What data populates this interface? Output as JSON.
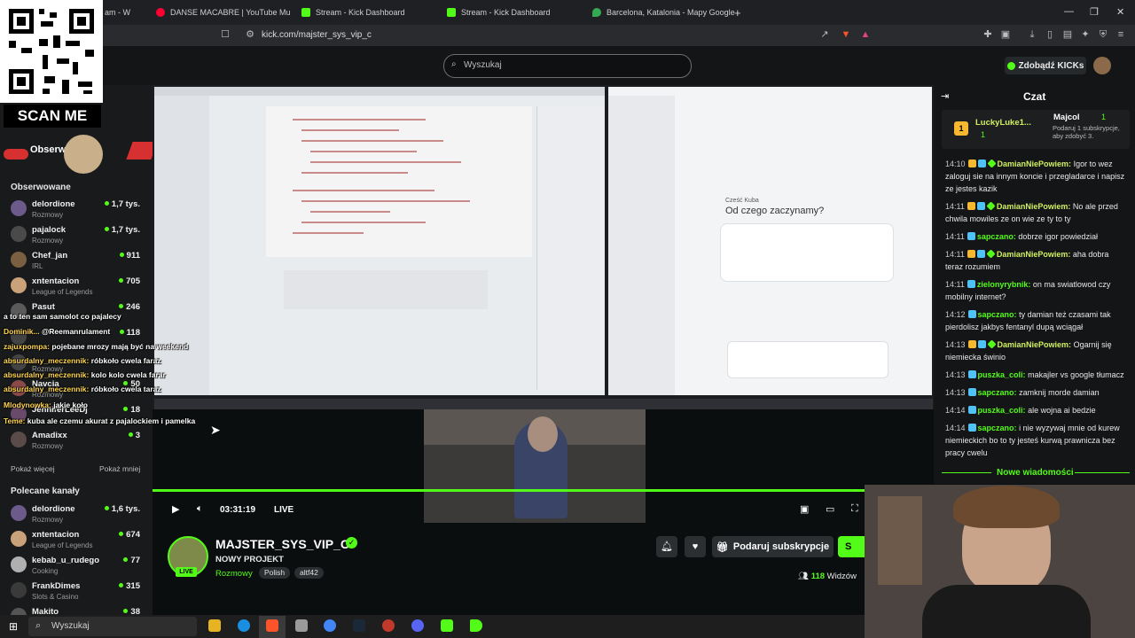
{
  "browser": {
    "tabs": [
      {
        "label": "am - W",
        "color": "#53fc18"
      },
      {
        "label": "DANSE MACABRE | YouTube Mu",
        "color": "#ff0033"
      },
      {
        "label": "Stream - Kick Dashboard",
        "color": "#53fc18"
      },
      {
        "label": "Stream - Kick Dashboard",
        "color": "#53fc18"
      },
      {
        "label": "Barcelona, Katalonia - Mapy Google",
        "color": "#34a853"
      }
    ],
    "new_tab": "+",
    "url": "kick.com/majster_sys_vip_c"
  },
  "kick": {
    "search_placeholder": "Wyszukaj",
    "get_kicks": "Zdobądź KICKs"
  },
  "overlay": {
    "scan_me": "SCAN ME",
    "follow_label": "Obserw",
    "chat_lines": [
      {
        "user": "",
        "text": "a to ten sam samolot co pajalecy"
      },
      {
        "user": "Dominik...",
        "text": "@Reemanrulament"
      },
      {
        "user": "zajuxpompa:",
        "text": "pojebane mrozy mają być na weekend"
      },
      {
        "user": "absurdalny_meczennik:",
        "text": "róbkoło cwela faraz"
      },
      {
        "user": "absurdalny_meczennik:",
        "text": "kolo kolo cwela farar"
      },
      {
        "user": "absurdalny_meczennik:",
        "text": "róbkoło cwela taraz"
      },
      {
        "user": "Mlodynowka:",
        "text": "jakie koło"
      },
      {
        "user": "Teme:",
        "text": "kuba ale czemu akurat z pajalockiem i pamelka"
      }
    ]
  },
  "sidebar": {
    "followed_title": "Obserwowane",
    "followed": [
      {
        "name": "delordione",
        "category": "Rozmowy",
        "viewers": "1,7 tys.",
        "color": "#6b5a8a"
      },
      {
        "name": "pajalock",
        "category": "Rozmowy",
        "viewers": "1,7 tys.",
        "color": "#4a4a4a"
      },
      {
        "name": "Chef_jan",
        "category": "IRL",
        "viewers": "911",
        "color": "#7a6040"
      },
      {
        "name": "xntentacion",
        "category": "League of Legends",
        "viewers": "705",
        "color": "#c9a27a"
      },
      {
        "name": "Pasut",
        "category": "",
        "viewers": "246",
        "color": "#5a5a5a"
      },
      {
        "name": "",
        "category": "",
        "viewers": "118",
        "color": "#444"
      },
      {
        "name": "",
        "category": "Rozmowy",
        "viewers": "",
        "color": "#444"
      },
      {
        "name": "Navcia",
        "category": "Rozmowy",
        "viewers": "50",
        "color": "#8a4a4a"
      },
      {
        "name": "JenniferLeeDj",
        "category": "",
        "viewers": "18",
        "color": "#6a4a6a"
      },
      {
        "name": "Amadixx",
        "category": "Rozmowy",
        "viewers": "3",
        "color": "#5a4a4a"
      }
    ],
    "show_more": "Pokaż więcej",
    "show_less": "Pokaż mniej",
    "recommended_title": "Polecane kanały",
    "recommended": [
      {
        "name": "delordione",
        "category": "Rozmowy",
        "viewers": "1,6 tys.",
        "color": "#6b5a8a"
      },
      {
        "name": "xntentacion",
        "category": "League of Legends",
        "viewers": "674",
        "color": "#c9a27a"
      },
      {
        "name": "kebab_u_rudego",
        "category": "Cooking",
        "viewers": "77",
        "color": "#b0b0b0"
      },
      {
        "name": "FrankDimes",
        "category": "Slots & Casino",
        "viewers": "315",
        "color": "#3a3a3a"
      },
      {
        "name": "Makito",
        "category": "",
        "viewers": "38",
        "color": "#555"
      }
    ]
  },
  "screen_share": {
    "gemini_greeting": "Cześć Kuba",
    "gemini_title": "Od czego zaczynamy?"
  },
  "player": {
    "time": "03:31:19",
    "live": "LIVE",
    "progress": 1.0
  },
  "channel": {
    "name": "MAJSTER_SYS_VIP_C",
    "title": "NOWY PROJEKT",
    "category": "Rozmowy",
    "tags": [
      "Polish",
      "altf42"
    ],
    "live_badge": "LIVE",
    "gift_sub": "Podaruj subskrypcje",
    "subscribe": "S",
    "viewers": "118",
    "viewers_label": "Widzów"
  },
  "chat": {
    "title": "Czat",
    "pinned": {
      "user1": "LuckyLuke1...",
      "user1_count": "1",
      "user2": "Majcol",
      "user2_count": "1",
      "note": "Podaruj 1 subskrypcje, aby zdobyć 3."
    },
    "messages": [
      {
        "time": "14:10",
        "user": "DamianNiePowiem:",
        "color": "#d0f060",
        "text": "Igor to wez zaloguj sie na innym koncie i przegladarce i napisz ze jestes kazik",
        "lines": 3
      },
      {
        "time": "14:11",
        "user": "DamianNiePowiem:",
        "color": "#d0f060",
        "text": "No ale przed chwila mowiles ze on wie ze ty to ty",
        "lines": 2
      },
      {
        "time": "14:11",
        "user": "sapczano:",
        "color": "#53fc18",
        "text": "dobrze igor powiedział",
        "lines": 1
      },
      {
        "time": "14:11",
        "user": "DamianNiePowiem:",
        "color": "#d0f060",
        "text": "aha dobra teraz rozumiem",
        "lines": 2
      },
      {
        "time": "14:11",
        "user": "zielonyrybnik:",
        "color": "#53fc18",
        "text": "on ma swiatlowod czy mobilny internet?",
        "lines": 2
      },
      {
        "time": "14:12",
        "user": "sapczano:",
        "color": "#53fc18",
        "text": "ty damian też czasami tak pierdolisz jakbys fentanyl dupą wciągał",
        "lines": 2
      },
      {
        "time": "14:13",
        "user": "DamianNiePowiem:",
        "color": "#d0f060",
        "text": "Ogarnij się niemiecka świnio",
        "lines": 2
      },
      {
        "time": "14:13",
        "user": "puszka_coli:",
        "color": "#53fc18",
        "text": "makajler vs google tłumacz",
        "lines": 1
      },
      {
        "time": "14:13",
        "user": "sapczano:",
        "color": "#53fc18",
        "text": "zamknij morde damian",
        "lines": 1
      },
      {
        "time": "14:14",
        "user": "puszka_coli:",
        "color": "#53fc18",
        "text": "ale wojna ai bedzie",
        "lines": 1
      },
      {
        "time": "14:14",
        "user": "sapczano:",
        "color": "#53fc18",
        "text": "i nie wyzywaj mnie od kurew niemieckich bo to ty jesteś kurwą prawnicza bez pracy cwelu",
        "lines": 3
      }
    ],
    "new_messages": "Nowe wiadomości"
  },
  "windows": {
    "search": "Wyszukaj"
  },
  "colors": {
    "accent": "#53fc18",
    "background": "#0b0e0f"
  }
}
